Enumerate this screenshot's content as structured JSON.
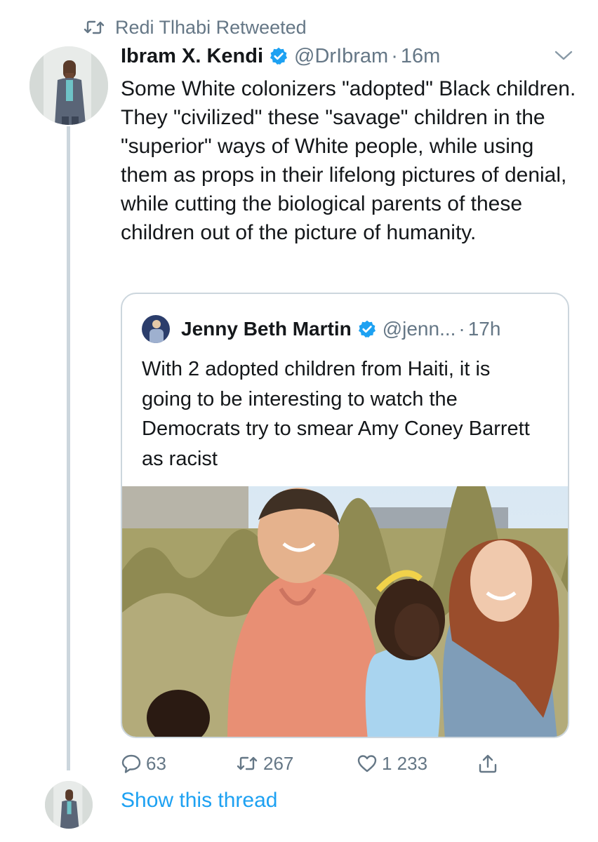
{
  "retweet_context": {
    "icon": "retweet-icon",
    "text": "Redi Tlhabi Retweeted"
  },
  "tweet": {
    "author_name": "Ibram X. Kendi",
    "handle": "@DrIbram",
    "separator": "·",
    "time": "16m",
    "verified": true,
    "text": "Some White colonizers \"adopted\" Black children. They \"civilized\" these \"savage\" children in the \"superior\" ways of White people, while using them as props in their lifelong pictures of denial, while cutting the biological parents of these children out of the picture of humanity."
  },
  "quoted_tweet": {
    "author_name": "Jenny Beth Martin",
    "handle": "@jenn...",
    "separator": "·",
    "time": "17h",
    "verified": true,
    "text": "With 2 adopted children from Haiti, it is going to be interesting to watch the Democrats try to smear Amy Coney Barrett as racist"
  },
  "actions": {
    "reply_count": "63",
    "retweet_count": "267",
    "like_count": "1 233"
  },
  "show_thread": "Show this thread",
  "colors": {
    "accent": "#1da1f2",
    "secondary_text": "#657786",
    "border": "#ccd6dd"
  }
}
